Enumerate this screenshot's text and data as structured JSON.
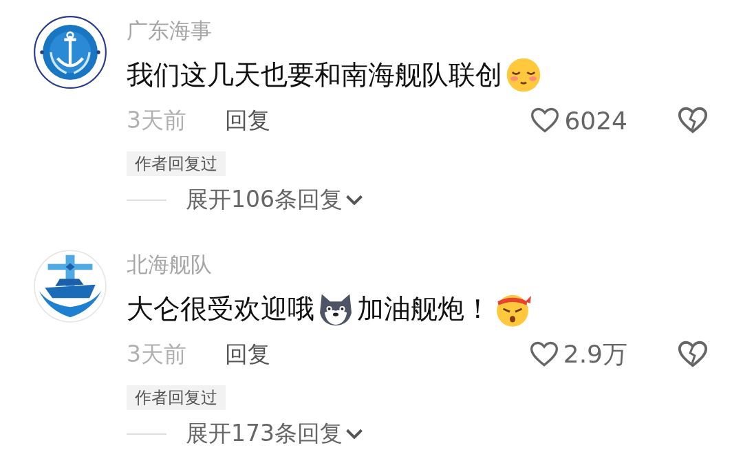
{
  "comments": [
    {
      "kind": "anchor",
      "author": "广东海事",
      "content": [
        {
          "kind": "text",
          "text": "我们这几天也要和南海舰队联创"
        },
        {
          "kind": "blush"
        }
      ],
      "time": "3天前",
      "reply": "回复",
      "likes": "6024",
      "tag": "作者回复过",
      "expand": "展开106条回复"
    },
    {
      "kind": "ship",
      "author": "北海舰队",
      "content": [
        {
          "kind": "text",
          "text": "大仑很受欢迎哦"
        },
        {
          "kind": "dog"
        },
        {
          "kind": "text",
          "text": "加油舰炮！"
        },
        {
          "kind": "angry"
        }
      ],
      "time": "3天前",
      "reply": "回复",
      "likes": "2.9万",
      "tag": "作者回复过",
      "expand": "展开173条回复"
    }
  ]
}
